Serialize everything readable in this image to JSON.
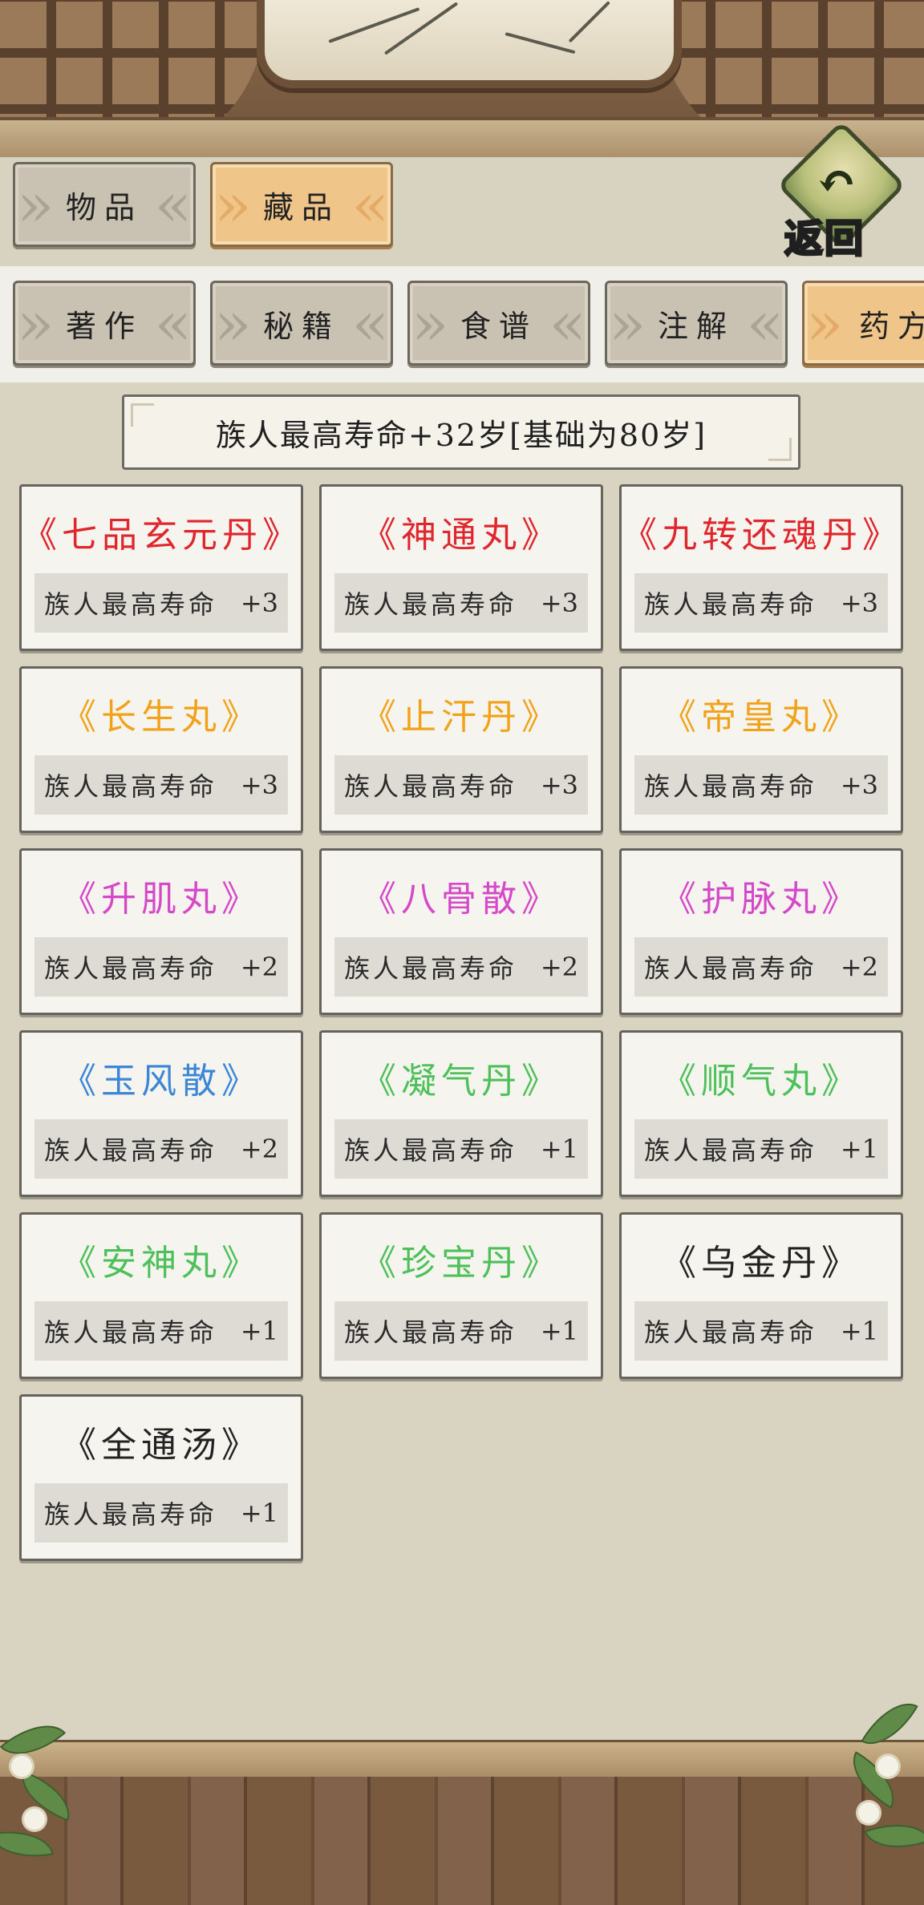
{
  "tabs": {
    "main": [
      {
        "label": "物品",
        "active": false
      },
      {
        "label": "藏品",
        "active": true
      }
    ],
    "sub": [
      {
        "label": "著作",
        "active": false
      },
      {
        "label": "秘籍",
        "active": false
      },
      {
        "label": "食谱",
        "active": false
      },
      {
        "label": "注解",
        "active": false
      },
      {
        "label": "药方",
        "active": true
      }
    ]
  },
  "return_button": {
    "label": "返回",
    "icon": "return-arrow-icon"
  },
  "summary": {
    "text": "族人最高寿命+32岁[基础为80岁]"
  },
  "colors": {
    "red": "#e0262d",
    "orange": "#f2a219",
    "purple": "#d548c8",
    "blue": "#3b86d6",
    "green": "#4dc05a",
    "black": "#222222"
  },
  "items": [
    {
      "name": "《七品玄元丹》",
      "effect": "族人最高寿命",
      "bonus": "+3",
      "color": "#e0262d"
    },
    {
      "name": "《神通丸》",
      "effect": "族人最高寿命",
      "bonus": "+3",
      "color": "#e0262d"
    },
    {
      "name": "《九转还魂丹》",
      "effect": "族人最高寿命",
      "bonus": "+3",
      "color": "#e0262d"
    },
    {
      "name": "《长生丸》",
      "effect": "族人最高寿命",
      "bonus": "+3",
      "color": "#f2a219"
    },
    {
      "name": "《止汗丹》",
      "effect": "族人最高寿命",
      "bonus": "+3",
      "color": "#f2a219"
    },
    {
      "name": "《帝皇丸》",
      "effect": "族人最高寿命",
      "bonus": "+3",
      "color": "#f2a219"
    },
    {
      "name": "《升肌丸》",
      "effect": "族人最高寿命",
      "bonus": "+2",
      "color": "#d548c8"
    },
    {
      "name": "《八骨散》",
      "effect": "族人最高寿命",
      "bonus": "+2",
      "color": "#d548c8"
    },
    {
      "name": "《护脉丸》",
      "effect": "族人最高寿命",
      "bonus": "+2",
      "color": "#d548c8"
    },
    {
      "name": "《玉风散》",
      "effect": "族人最高寿命",
      "bonus": "+2",
      "color": "#3b86d6"
    },
    {
      "name": "《凝气丹》",
      "effect": "族人最高寿命",
      "bonus": "+1",
      "color": "#4dc05a"
    },
    {
      "name": "《顺气丸》",
      "effect": "族人最高寿命",
      "bonus": "+1",
      "color": "#4dc05a"
    },
    {
      "name": "《安神丸》",
      "effect": "族人最高寿命",
      "bonus": "+1",
      "color": "#4dc05a"
    },
    {
      "name": "《珍宝丹》",
      "effect": "族人最高寿命",
      "bonus": "+1",
      "color": "#4dc05a"
    },
    {
      "name": "《乌金丹》",
      "effect": "族人最高寿命",
      "bonus": "+1",
      "color": "#222222"
    },
    {
      "name": "《全通汤》",
      "effect": "族人最高寿命",
      "bonus": "+1",
      "color": "#222222"
    }
  ]
}
